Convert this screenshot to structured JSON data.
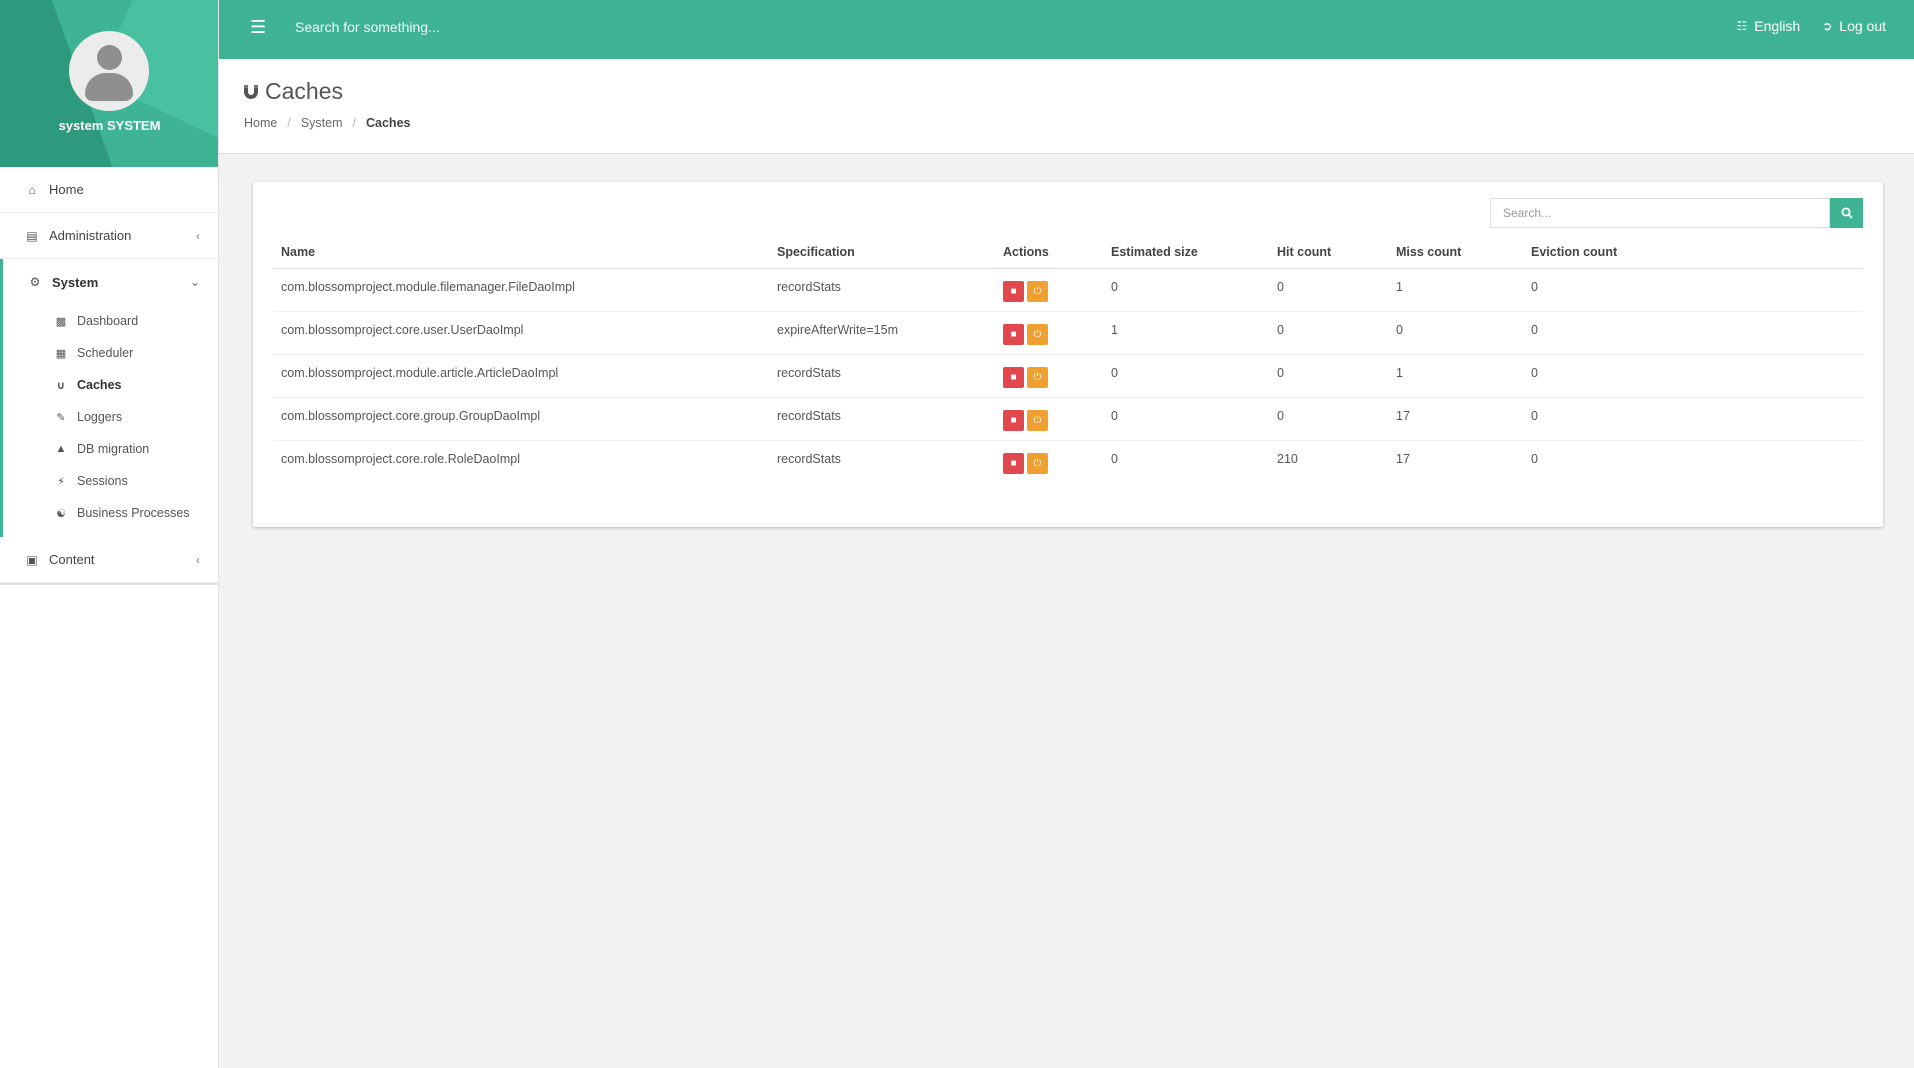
{
  "sidebar": {
    "user_name": "system SYSTEM",
    "items": [
      {
        "label": "Home",
        "icon": "home-icon"
      },
      {
        "label": "Administration",
        "icon": "list-icon"
      },
      {
        "label": "System",
        "icon": "cogs-icon"
      },
      {
        "label": "Content",
        "icon": "book-icon"
      }
    ],
    "system_subitems": [
      {
        "label": "Dashboard",
        "icon": "bar-chart-icon"
      },
      {
        "label": "Scheduler",
        "icon": "calendar-icon"
      },
      {
        "label": "Caches",
        "icon": "magnet-icon"
      },
      {
        "label": "Loggers",
        "icon": "pencil-icon"
      },
      {
        "label": "DB migration",
        "icon": "flask-icon"
      },
      {
        "label": "Sessions",
        "icon": "plug-icon"
      },
      {
        "label": "Business Processes",
        "icon": "sitemap-icon"
      }
    ],
    "active_subitem": "Caches"
  },
  "topbar": {
    "search_placeholder": "Search for something...",
    "language_label": "English",
    "logout_label": "Log out"
  },
  "page": {
    "title": "Caches",
    "breadcrumb": [
      "Home",
      "System",
      "Caches"
    ]
  },
  "panel": {
    "search_placeholder": "Search...",
    "columns": [
      "Name",
      "Specification",
      "Actions",
      "Estimated size",
      "Hit count",
      "Miss count",
      "Eviction count"
    ],
    "rows": [
      {
        "name": "com.blossomproject.module.filemanager.FileDaoImpl",
        "spec": "recordStats",
        "size": "0",
        "hit": "0",
        "miss": "1",
        "evict": "0"
      },
      {
        "name": "com.blossomproject.core.user.UserDaoImpl",
        "spec": "expireAfterWrite=15m",
        "size": "1",
        "hit": "0",
        "miss": "0",
        "evict": "0"
      },
      {
        "name": "com.blossomproject.module.article.ArticleDaoImpl",
        "spec": "recordStats",
        "size": "0",
        "hit": "0",
        "miss": "1",
        "evict": "0"
      },
      {
        "name": "com.blossomproject.core.group.GroupDaoImpl",
        "spec": "recordStats",
        "size": "0",
        "hit": "0",
        "miss": "17",
        "evict": "0"
      },
      {
        "name": "com.blossomproject.core.role.RoleDaoImpl",
        "spec": "recordStats",
        "size": "0",
        "hit": "210",
        "miss": "17",
        "evict": "0"
      }
    ]
  },
  "colors": {
    "accent": "#3fb495",
    "danger": "#e0484e",
    "warning": "#f0a030",
    "background": "#f2f2f2"
  }
}
